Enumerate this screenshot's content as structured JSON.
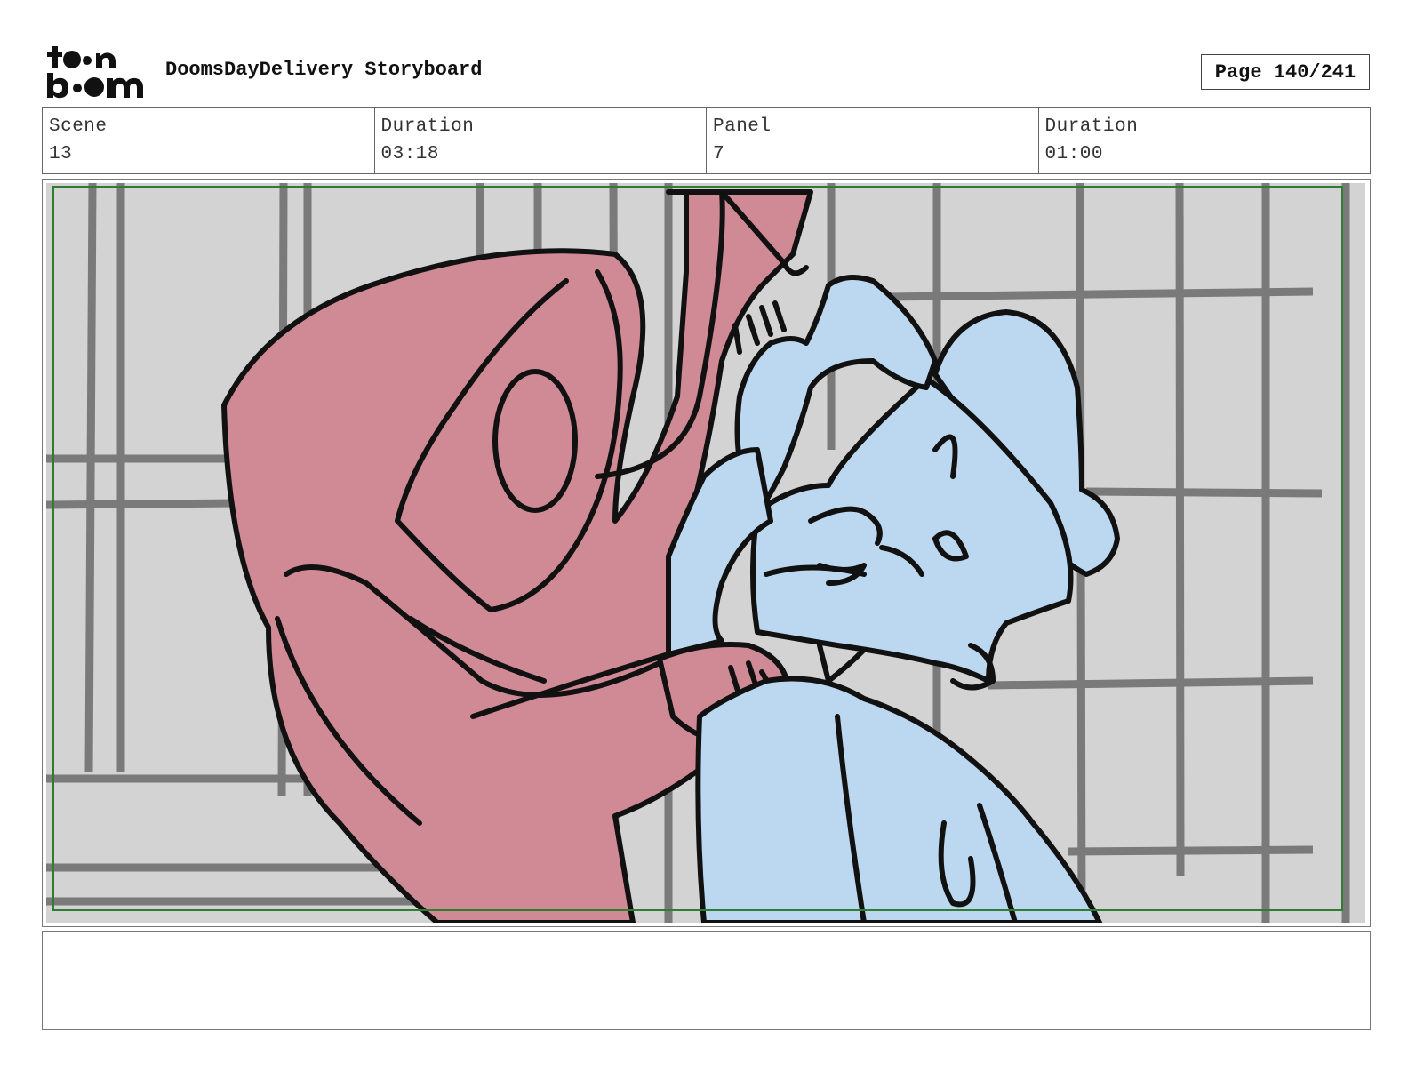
{
  "header": {
    "logo_text_top": "toon",
    "logo_text_bottom": "boom",
    "title": "DoomsDayDelivery Storyboard",
    "page": "Page 140/241"
  },
  "info": [
    {
      "label": "Scene",
      "value": "13"
    },
    {
      "label": "Duration",
      "value": "03:18"
    },
    {
      "label": "Panel",
      "value": "7"
    },
    {
      "label": "Duration",
      "value": "01:00"
    }
  ],
  "panel": {
    "background_color": "#d3d3d3",
    "grid_color": "#7a7a7a",
    "safe_frame_color": "#2e7d32",
    "hooded_figure_color": "#d08a96",
    "delivery_boy_color": "#bcd8f0",
    "outline_color": "#111111"
  },
  "notes": {
    "text": ""
  }
}
